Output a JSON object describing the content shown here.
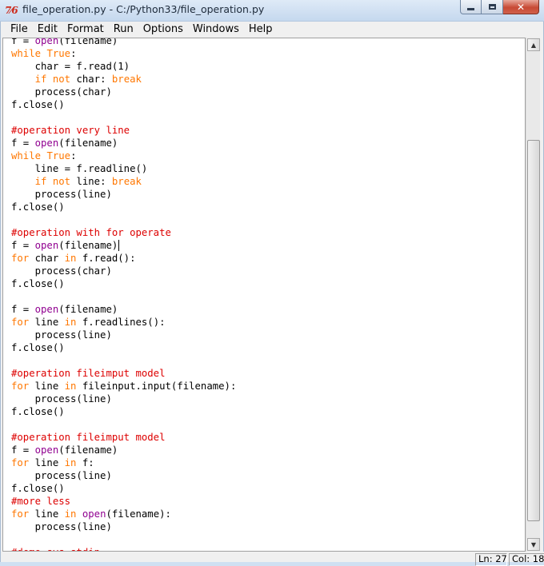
{
  "window": {
    "icon_text": "7⁄6",
    "title": "file_operation.py - C:/Python33/file_operation.py"
  },
  "menu": [
    "File",
    "Edit",
    "Format",
    "Run",
    "Options",
    "Windows",
    "Help"
  ],
  "editor": {
    "lines": [
      [
        [
          "",
          "f = "
        ],
        [
          "bi",
          "open"
        ],
        [
          "",
          "(filename)"
        ]
      ],
      [
        [
          "kw",
          "while"
        ],
        [
          "",
          " "
        ],
        [
          "kw",
          "True"
        ],
        [
          "",
          ":"
        ]
      ],
      [
        [
          "",
          "    char = f.read(1)"
        ]
      ],
      [
        [
          "",
          "    "
        ],
        [
          "kw",
          "if"
        ],
        [
          "",
          " "
        ],
        [
          "kw",
          "not"
        ],
        [
          "",
          " char: "
        ],
        [
          "kw",
          "break"
        ]
      ],
      [
        [
          "",
          "    process(char)"
        ]
      ],
      [
        [
          "",
          "f.close()"
        ]
      ],
      [
        [
          "",
          ""
        ]
      ],
      [
        [
          "cm",
          "#operation very line"
        ]
      ],
      [
        [
          "",
          "f = "
        ],
        [
          "bi",
          "open"
        ],
        [
          "",
          "(filename)"
        ]
      ],
      [
        [
          "kw",
          "while"
        ],
        [
          "",
          " "
        ],
        [
          "kw",
          "True"
        ],
        [
          "",
          ":"
        ]
      ],
      [
        [
          "",
          "    line = f.readline()"
        ]
      ],
      [
        [
          "",
          "    "
        ],
        [
          "kw",
          "if"
        ],
        [
          "",
          " "
        ],
        [
          "kw",
          "not"
        ],
        [
          "",
          " line: "
        ],
        [
          "kw",
          "break"
        ]
      ],
      [
        [
          "",
          "    process(line)"
        ]
      ],
      [
        [
          "",
          "f.close()"
        ]
      ],
      [
        [
          "",
          ""
        ]
      ],
      [
        [
          "cm",
          "#operation with for operate"
        ]
      ],
      [
        [
          "",
          "f = "
        ],
        [
          "bi",
          "open"
        ],
        [
          "",
          "(filename)"
        ],
        [
          "caret",
          ""
        ]
      ],
      [
        [
          "kw",
          "for"
        ],
        [
          "",
          " char "
        ],
        [
          "kw",
          "in"
        ],
        [
          "",
          " f.read():"
        ]
      ],
      [
        [
          "",
          "    process(char)"
        ]
      ],
      [
        [
          "",
          "f.close()"
        ]
      ],
      [
        [
          "",
          ""
        ]
      ],
      [
        [
          "",
          "f = "
        ],
        [
          "bi",
          "open"
        ],
        [
          "",
          "(filename)"
        ]
      ],
      [
        [
          "kw",
          "for"
        ],
        [
          "",
          " line "
        ],
        [
          "kw",
          "in"
        ],
        [
          "",
          " f.readlines():"
        ]
      ],
      [
        [
          "",
          "    process(line)"
        ]
      ],
      [
        [
          "",
          "f.close()"
        ]
      ],
      [
        [
          "",
          ""
        ]
      ],
      [
        [
          "cm",
          "#operation fileimput model"
        ]
      ],
      [
        [
          "kw",
          "for"
        ],
        [
          "",
          " line "
        ],
        [
          "kw",
          "in"
        ],
        [
          "",
          " fileinput.input(filename):"
        ]
      ],
      [
        [
          "",
          "    process(line)"
        ]
      ],
      [
        [
          "",
          "f.close()"
        ]
      ],
      [
        [
          "",
          ""
        ]
      ],
      [
        [
          "cm",
          "#operation fileimput model"
        ]
      ],
      [
        [
          "",
          "f = "
        ],
        [
          "bi",
          "open"
        ],
        [
          "",
          "(filename)"
        ]
      ],
      [
        [
          "kw",
          "for"
        ],
        [
          "",
          " line "
        ],
        [
          "kw",
          "in"
        ],
        [
          "",
          " f:"
        ]
      ],
      [
        [
          "",
          "    process(line)"
        ]
      ],
      [
        [
          "",
          "f.close()"
        ]
      ],
      [
        [
          "cm",
          "#more less"
        ]
      ],
      [
        [
          "kw",
          "for"
        ],
        [
          "",
          " line "
        ],
        [
          "kw",
          "in"
        ],
        [
          "",
          " "
        ],
        [
          "bi",
          "open"
        ],
        [
          "",
          "(filename):"
        ]
      ],
      [
        [
          "",
          "    process(line)"
        ]
      ],
      [
        [
          "",
          ""
        ]
      ],
      [
        [
          "cm",
          "#demo sys.stdin"
        ]
      ]
    ]
  },
  "status": {
    "line": "Ln: 27",
    "col": "Col: 18"
  },
  "colors": {
    "keyword": "#ff7700",
    "builtin": "#900090",
    "comment": "#dd0000"
  }
}
